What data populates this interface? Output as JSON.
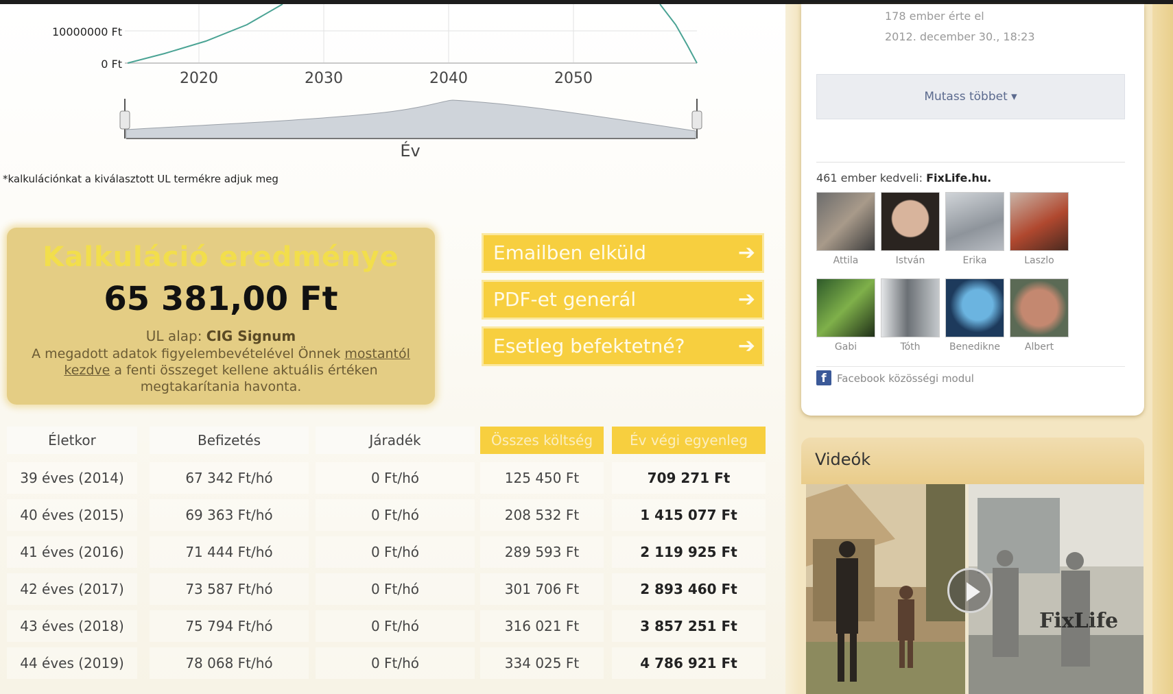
{
  "chart": {
    "y_ticks": [
      "10000000 Ft",
      "0 Ft"
    ],
    "x_ticks": [
      "2020",
      "2030",
      "2040",
      "2050"
    ],
    "range_label": "Év"
  },
  "footnote": "*kalkulációnkat a kiválasztott UL termékre adjuk meg",
  "result": {
    "title": "Kalkuláció eredménye",
    "amount": "65 381,00 Ft",
    "base_prefix": "UL alap: ",
    "base_value": "CIG Signum",
    "desc_1": "A megadott adatok figyelembevételével Önnek",
    "desc_link": "mostantól kezdve",
    "desc_2": "a fenti összeget kellene aktuális értéken megtakarítania havonta."
  },
  "actions": {
    "email_label": "Emailben elküld",
    "pdf_label": "PDF-et generál",
    "invest_label": "Esetleg befektetné?",
    "arrow": "➔"
  },
  "table": {
    "headers": [
      "Életkor",
      "Befizetés",
      "Járadék",
      "Összes költség",
      "Év végi egyenleg"
    ],
    "rows": [
      [
        "39 éves (2014)",
        "67 342 Ft/hó",
        "0 Ft/hó",
        "125 450 Ft",
        "709 271 Ft"
      ],
      [
        "40 éves (2015)",
        "69 363 Ft/hó",
        "0 Ft/hó",
        "208 532 Ft",
        "1 415 077 Ft"
      ],
      [
        "41 éves (2016)",
        "71 444 Ft/hó",
        "0 Ft/hó",
        "289 593 Ft",
        "2 119 925 Ft"
      ],
      [
        "42 éves (2017)",
        "73 587 Ft/hó",
        "0 Ft/hó",
        "301 706 Ft",
        "2 893 460 Ft"
      ],
      [
        "43 éves (2018)",
        "75 794 Ft/hó",
        "0 Ft/hó",
        "316 021 Ft",
        "3 857 251 Ft"
      ],
      [
        "44 éves (2019)",
        "78 068 Ft/hó",
        "0 Ft/hó",
        "334 025 Ft",
        "4 786 921 Ft"
      ]
    ]
  },
  "facebook": {
    "meta_1": "178 ember érte el",
    "meta_2": "2012. december 30., 18:23",
    "more_label": "Mutass többet",
    "more_caret": "▾",
    "likes_prefix": "461 ember kedveli: ",
    "likes_page": "FixLife.hu.",
    "faces": [
      "Attila",
      "István",
      "Erika",
      "Laszlo",
      "Gabi",
      "Tóth",
      "Benedikne",
      "Albert"
    ],
    "plugin_label": "Facebook közösségi modul",
    "logo_letter": "f"
  },
  "videos": {
    "title": "Videók",
    "watermark": "FixLife"
  },
  "colors": {
    "accent": "#f7cf3f",
    "result_bg": "#e4cd84",
    "facebook": "#3b5998",
    "line": "#4aa394"
  }
}
